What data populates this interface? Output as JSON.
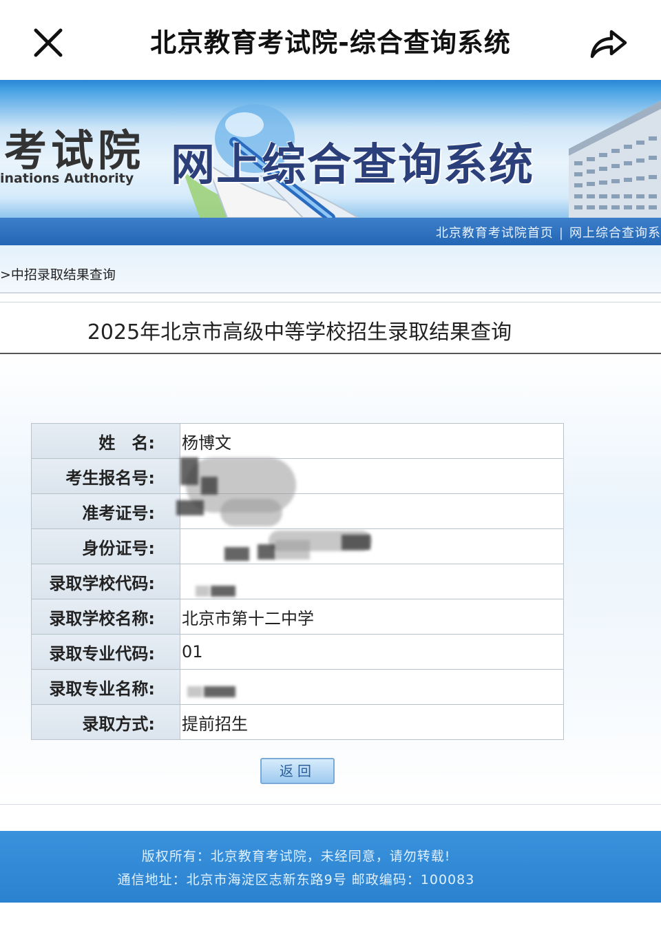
{
  "appbar": {
    "title": "北京教育考试院-综合查询系统",
    "close_icon": "close-icon",
    "share_icon": "share-icon"
  },
  "banner": {
    "logo_cn": "考试院",
    "logo_en": "inations Authority",
    "system_title": "网上综合查询系统"
  },
  "nav": {
    "links": [
      "北京教育考试院首页",
      "网上综合查询系"
    ],
    "separator": "|"
  },
  "breadcrumb": ">中招录取结果查询",
  "query_title": "2025年北京市高级中等学校招生录取结果查询",
  "result": {
    "rows": [
      {
        "label": "姓　名:",
        "value": "杨博文"
      },
      {
        "label": "考生报名号:",
        "value": ""
      },
      {
        "label": "准考证号:",
        "value": ""
      },
      {
        "label": "身份证号:",
        "value": ""
      },
      {
        "label": "录取学校代码:",
        "value": ""
      },
      {
        "label": "录取学校名称:",
        "value": "北京市第十二中学"
      },
      {
        "label": "录取专业代码:",
        "value": "01"
      },
      {
        "label": "录取专业名称:",
        "value": ""
      },
      {
        "label": "录取方式:",
        "value": "提前招生"
      }
    ]
  },
  "actions": {
    "return_label": "返回"
  },
  "footer": {
    "line1": "版权所有：北京教育考试院，未经同意，请勿转载!",
    "line2": "通信地址：北京市海淀区志新东路9号  邮政编码：100083"
  },
  "colors": {
    "banner_blue": "#2a86d6",
    "nav_blue": "#2366b5",
    "footer_blue": "#2b82d0",
    "title_navy": "#2b3f7a"
  }
}
